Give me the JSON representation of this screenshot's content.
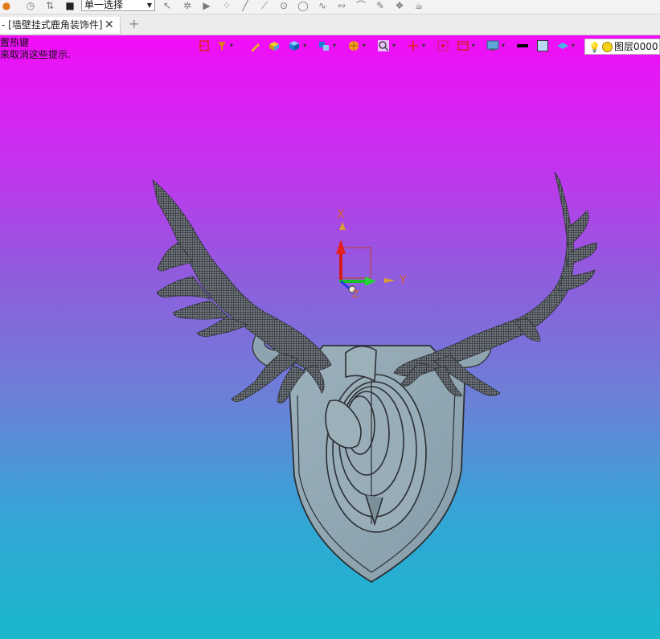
{
  "toolbar": {
    "selection_filter": "单一选择"
  },
  "tab": {
    "title": "- [墙壁挂式鹿角装饰件]",
    "close_glyph": "✕",
    "new_glyph": "+"
  },
  "hint": {
    "line1": "置热键",
    "line2": "来取消这些提示."
  },
  "layer": {
    "name": "图层0000",
    "color": "#f7d21a"
  },
  "triad": {
    "x_label": "X",
    "y_label": "Y",
    "z_label": "Z"
  },
  "colors": {
    "bg_top": "#f20df7",
    "bg_bottom": "#18b7cc",
    "plaque": "#94a9b4",
    "antler": "#4a4f55"
  }
}
